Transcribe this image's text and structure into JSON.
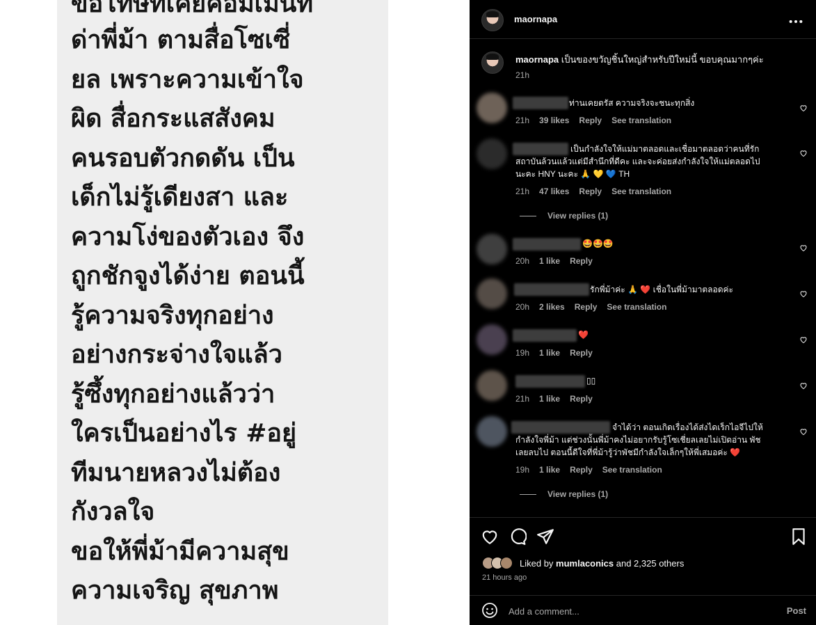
{
  "image_text": {
    "lines": [
      "ขอโทษที่เคยคอมเมนท์",
      "ด่าพี่ม้า ตามสื่อโซเซี่",
      "ยล เพราะความเข้าใจ",
      "ผิด สื่อกระแสสังคม",
      "คนรอบตัวกดดัน เป็น",
      "เด็กไม่รู้เดียงสา และ",
      "ความโง่ของตัวเอง จึง",
      "ถูกชักจูงได้ง่าย ตอนนี้",
      "รู้ความจริงทุกอย่าง",
      "อย่างกระจ่างใจแล้ว",
      "รู้ซึ้งทุกอย่างแล้วว่า",
      "ใครเป็นอย่างไร  #อยู่",
      "ทีมนายหลวงไม่ต้อง",
      "กังวลใจ",
      "ขอให้พี่ม้ามีความสุข",
      "ความเจริญ สุขภาพ"
    ]
  },
  "post": {
    "username": "maornapa",
    "caption_user": "maornapa",
    "caption": "เป็นของขวัญชิ้นใหญ่สำหรับปีใหม่นี้ ขอบคุณมากๆค่ะ",
    "caption_time": "21h"
  },
  "comments": [
    {
      "text": "ท่านเคยตรัส ความจริงจะชนะทุกสิ่ง",
      "time": "21h",
      "likes": "39 likes",
      "reply": "Reply",
      "translation": "See translation"
    },
    {
      "text_line1": "เป็นกำลังใจให้แม่มาตลอดและเชื่อมาตลอดว่าคนที่รัก",
      "text_line2": "สถาบันล้วนแล้วแต่มีสำนึกที่ดีคะ และจะค่อยส่งกำลังใจให้แม่ตลอดไป",
      "text_line3": "นะคะ HNY นะคะ 🙏 💛 💙 TH",
      "time": "21h",
      "likes": "47 likes",
      "reply": "Reply",
      "translation": "See translation",
      "view_replies": "View replies (1)"
    },
    {
      "text": "🤩🤩🤩",
      "time": "20h",
      "likes": "1 like",
      "reply": "Reply"
    },
    {
      "text": "รักพี่ม้าค่ะ 🙏 ❤️  เชื่อในพี่ม้ามาตลอดค่ะ",
      "time": "20h",
      "likes": "2 likes",
      "reply": "Reply",
      "translation": "See translation"
    },
    {
      "text": "❤️",
      "time": "19h",
      "likes": "1 like",
      "reply": "Reply"
    },
    {
      "text": "▯▯",
      "time": "21h",
      "likes": "1 like",
      "reply": "Reply"
    },
    {
      "text_line1": "จำได้ว่า ตอนเกิดเรื่องได้ส่งไดเร็กไอจีไปให้",
      "text_line2": "กำลังใจพี่ม้า แต่ช่วงนั้นพี่ม้าคงไม่อยากรับรู้โซเชี่ยลเลยไม่เปิดอ่าน พัช",
      "text_line3": "เลยลบไป ตอนนี้ดีใจที่พี่ม้ารู้ว่าพัชมีกำลังใจเล็กๆให้พี่เสมอค่ะ ❤️",
      "time": "19h",
      "likes": "1 like",
      "reply": "Reply",
      "translation": "See translation",
      "view_replies": "View replies (1)"
    }
  ],
  "footer": {
    "liked_by_prefix": "Liked by ",
    "liked_by_user": "mumlaconics",
    "liked_by_suffix": " and 2,325 others",
    "time_ago": "21 hours ago",
    "comment_placeholder": "Add a comment...",
    "post_label": "Post"
  },
  "colors": {
    "background": "#000000",
    "text": "#f5f5f5",
    "secondary_text": "#a8a8a8",
    "heart": "#ed4956",
    "image_background": "#eeeeee"
  },
  "icons": [
    "more-icon",
    "heart-icon",
    "comment-icon",
    "share-icon",
    "bookmark-icon",
    "emoji-icon"
  ]
}
